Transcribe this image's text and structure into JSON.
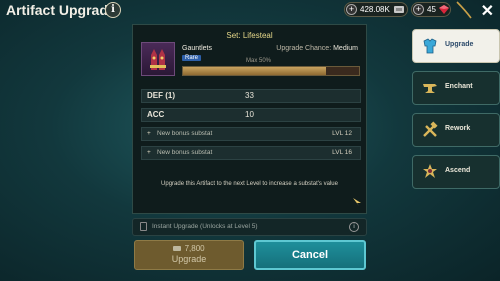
{
  "header": {
    "title": "Artifact Upgrade",
    "info_icon": "info-icon",
    "silver": "428.08K",
    "gems": "45",
    "close_icon": "close-icon"
  },
  "artifact": {
    "set_title": "Set: Lifesteal",
    "name": "Gauntlets",
    "rarity": "Rare",
    "upgrade_chance_label": "Upgrade Chance:",
    "upgrade_chance_value": "Medium",
    "max_label": "Max 50%",
    "chance_fill_fraction": 0.81
  },
  "stats": [
    {
      "label": "DEF (1)",
      "value": "33"
    },
    {
      "label": "ACC",
      "value": "10"
    }
  ],
  "substats": [
    {
      "label": "New bonus substat",
      "level": "LVL 12"
    },
    {
      "label": "New bonus substat",
      "level": "LVL 16"
    }
  ],
  "note": "Upgrade this Artifact to the next Level to increase a substat's value",
  "instant_upgrade": "Instant Upgrade (Unlocks at Level 5)",
  "buttons": {
    "upgrade_cost": "7,800",
    "upgrade_label": "Upgrade",
    "cancel_label": "Cancel"
  },
  "tabs": [
    {
      "label": "Upgrade",
      "icon": "armor-icon",
      "active": true
    },
    {
      "label": "Enchant",
      "icon": "anvil-icon",
      "active": false
    },
    {
      "label": "Rework",
      "icon": "tools-icon",
      "active": false
    },
    {
      "label": "Ascend",
      "icon": "ascend-icon",
      "active": false
    }
  ],
  "colors": {
    "accent_cyan": "#1f8f9b",
    "gold": "#e7d98a",
    "rare_blue": "#2d5fa8"
  }
}
